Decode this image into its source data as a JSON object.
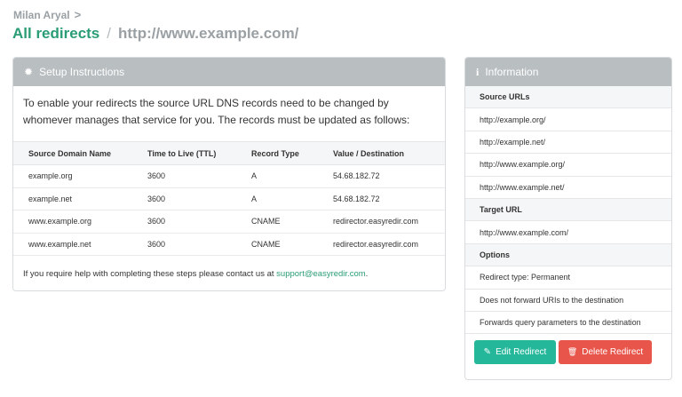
{
  "breadcrumb": {
    "user": "Milan Aryal",
    "chevron": ">"
  },
  "header": {
    "title": "All redirects",
    "separator": "/",
    "subtitle": "http://www.example.com/"
  },
  "setup": {
    "icon": "gear-icon",
    "icon_glyph": "✹",
    "title": "Setup Instructions",
    "intro": "To enable your redirects the source URL DNS records need to be changed by whomever manages that service for you. The records must be updated as follows:",
    "columns": [
      "Source Domain Name",
      "Time to Live (TTL)",
      "Record Type",
      "Value / Destination"
    ],
    "rows": [
      [
        "example.org",
        "3600",
        "A",
        "54.68.182.72"
      ],
      [
        "example.net",
        "3600",
        "A",
        "54.68.182.72"
      ],
      [
        "www.example.org",
        "3600",
        "CNAME",
        "redirector.easyredir.com"
      ],
      [
        "www.example.net",
        "3600",
        "CNAME",
        "redirector.easyredir.com"
      ]
    ],
    "help_text": "If you require help with completing these steps please contact us at ",
    "help_link": "support@easyredir.com",
    "help_end": "."
  },
  "info": {
    "icon": "info-icon",
    "icon_glyph": "i",
    "title": "Information",
    "source_header": "Source URLs",
    "source_urls": [
      "http://example.org/",
      "http://example.net/",
      "http://www.example.org/",
      "http://www.example.net/"
    ],
    "target_header": "Target URL",
    "target_url": "http://www.example.com/",
    "options_header": "Options",
    "options": [
      "Redirect type: Permanent",
      "Does not forward URIs to the destination",
      "Forwards query parameters to the destination"
    ]
  },
  "actions": {
    "edit_icon": "pencil-icon",
    "edit_glyph": "✎",
    "edit_label": "Edit Redirect",
    "delete_icon": "trash-icon",
    "delete_glyph": "🗑",
    "delete_label": "Delete Redirect"
  },
  "colors": {
    "accent": "#2a9d74",
    "panel_header": "#b9bec1",
    "edit": "#25b79a",
    "delete": "#e8554a"
  }
}
